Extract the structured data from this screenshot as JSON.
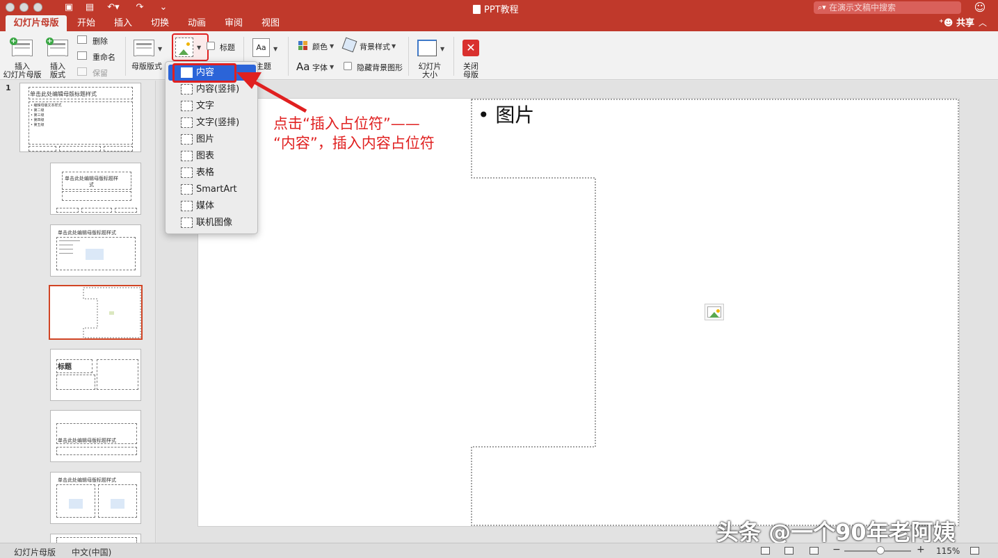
{
  "window": {
    "title": "PPT教程",
    "search_placeholder": "在演示文稿中搜索"
  },
  "tabs": [
    {
      "label": "幻灯片母版",
      "active": true
    },
    {
      "label": "开始"
    },
    {
      "label": "插入"
    },
    {
      "label": "切换"
    },
    {
      "label": "动画"
    },
    {
      "label": "审阅"
    },
    {
      "label": "视图"
    }
  ],
  "share_label": "共享",
  "ribbon": {
    "insert_master": "插入\n幻灯片母版",
    "insert_layout": "插入\n版式",
    "delete": "删除",
    "rename": "重命名",
    "preserve": "保留",
    "master_layout": "母版版式",
    "title_checkbox": "标题",
    "theme": "主题",
    "colors": "颜色",
    "fonts": "字体",
    "background_styles": "背景样式",
    "hide_background": "隐藏背景图形",
    "slide_size": "幻灯片\n大小",
    "close_master": "关闭\n母版"
  },
  "placeholder_menu": {
    "items": [
      "内容",
      "内容(竖排)",
      "文字",
      "文字(竖排)",
      "图片",
      "图表",
      "表格",
      "SmartArt",
      "媒体",
      "联机图像"
    ],
    "highlighted": "内容"
  },
  "thumbnails": {
    "slide_number": "1",
    "master_title": "单击此处编辑母版标题样式",
    "master_text_levels": [
      "• 编辑母版文本样式",
      "• 第二级",
      "• 第三级",
      "• 第四级",
      "• 第五级"
    ],
    "layout_title": "单击此处编辑母版标题样式",
    "layout_title_wrapped": "单击此处编辑母版标题样\n式",
    "picture_caption_title": "标题"
  },
  "slide": {
    "bullet_text": "图片"
  },
  "annotation": {
    "line1": "点击“插入占位符”——",
    "line2": "“内容”，插入内容占位符"
  },
  "watermark": "头条 @一个90年老阿姨",
  "statusbar": {
    "view_name": "幻灯片母版",
    "language": "中文(中国)",
    "zoom": "115%"
  },
  "colors": {
    "accent": "#c0392b",
    "menu_highlight": "#2b64d8",
    "annotation": "#e02020"
  }
}
